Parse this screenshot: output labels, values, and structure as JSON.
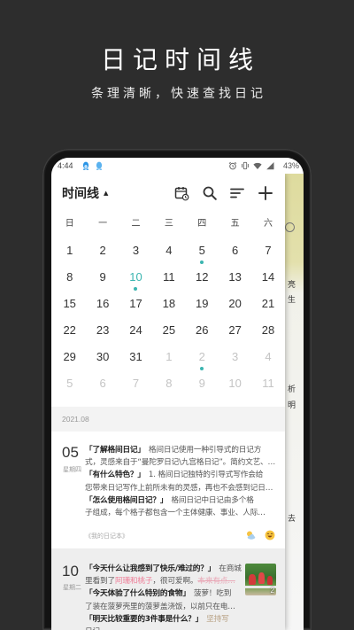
{
  "promo": {
    "title": "日记时间线",
    "subtitle": "条理清晰，快速查找日记"
  },
  "status_bar": {
    "time": "4:44",
    "battery": "43%",
    "left_icons": [
      "qq-icon",
      "qq-icon"
    ],
    "right_icons": [
      "alarm-icon",
      "vibrate-icon",
      "wifi-icon",
      "signal-icon"
    ]
  },
  "header": {
    "title": "时间线",
    "caret": "▲",
    "actions": [
      "calendar-icon",
      "search-icon",
      "sort-icon",
      "add-icon"
    ]
  },
  "calendar": {
    "weekdays": [
      "日",
      "一",
      "二",
      "三",
      "四",
      "五",
      "六"
    ],
    "weeks": [
      [
        {
          "d": "1"
        },
        {
          "d": "2"
        },
        {
          "d": "3"
        },
        {
          "d": "4"
        },
        {
          "d": "5",
          "has_entry": true
        },
        {
          "d": "6"
        },
        {
          "d": "7"
        }
      ],
      [
        {
          "d": "8"
        },
        {
          "d": "9"
        },
        {
          "d": "10",
          "has_entry": true,
          "selected": true
        },
        {
          "d": "11"
        },
        {
          "d": "12"
        },
        {
          "d": "13"
        },
        {
          "d": "14"
        }
      ],
      [
        {
          "d": "15"
        },
        {
          "d": "16"
        },
        {
          "d": "17"
        },
        {
          "d": "18"
        },
        {
          "d": "19"
        },
        {
          "d": "20"
        },
        {
          "d": "21"
        }
      ],
      [
        {
          "d": "22"
        },
        {
          "d": "23"
        },
        {
          "d": "24"
        },
        {
          "d": "25"
        },
        {
          "d": "26"
        },
        {
          "d": "27"
        },
        {
          "d": "28"
        }
      ],
      [
        {
          "d": "29"
        },
        {
          "d": "30"
        },
        {
          "d": "31"
        },
        {
          "d": "1",
          "other_month": true
        },
        {
          "d": "2",
          "other_month": true,
          "has_entry": true
        },
        {
          "d": "3",
          "other_month": true
        },
        {
          "d": "4",
          "other_month": true
        }
      ],
      [
        {
          "d": "5",
          "other_month": true
        },
        {
          "d": "6",
          "other_month": true
        },
        {
          "d": "7",
          "other_month": true
        },
        {
          "d": "8",
          "other_month": true
        },
        {
          "d": "9",
          "other_month": true
        },
        {
          "d": "10",
          "other_month": true
        },
        {
          "d": "11",
          "other_month": true
        }
      ]
    ]
  },
  "timeline": {
    "month_label": "2021.08",
    "entries": [
      {
        "day": "05",
        "weekday": "星期四",
        "lines": [
          [
            {
              "t": "「了解格间日记」",
              "style": "question"
            },
            {
              "t": "格间日记使用一种引导式的日记方"
            }
          ],
          [
            {
              "t": "式，灵感来自于“曼陀罗日记\\九宫格日记”。简约文艺、…"
            }
          ],
          [
            {
              "t": "「有什么特色？」",
              "style": "question"
            },
            {
              "t": "1. 格间日记独特的引导式写作会给"
            }
          ],
          [
            {
              "t": "您带来日记写作上前所未有的灵感，再也不会感到记日…"
            }
          ],
          [
            {
              "t": "「怎么使用格间日记？」",
              "style": "question"
            },
            {
              "t": "格间日记中日记由多个格"
            }
          ],
          [
            {
              "t": "子组成，每个格子都包含一个主体健康、事业、人际…"
            }
          ]
        ],
        "notebook": "《我的日记本》",
        "weather_icon": "sun-cloud-icon",
        "mood_icon": "laughing-face-icon"
      },
      {
        "day": "10",
        "weekday": "星期二",
        "lines": [
          [
            {
              "t": "「今天什么让我感到了快乐/难过的？」",
              "style": "question"
            },
            {
              "t": "在商城"
            }
          ],
          [
            {
              "t": "里看到了"
            },
            {
              "t": "阿珊和桃子",
              "style": "highlight"
            },
            {
              "t": "，很可爱啊。"
            },
            {
              "t": "本来有点…",
              "style": "strike"
            }
          ],
          [
            {
              "t": "「今天体验了什么特别的食物」",
              "style": "question"
            },
            {
              "t": "菠萝！吃到"
            }
          ],
          [
            {
              "t": "了装在菠萝壳里的菠萝盖浇饭，以前只在电…"
            }
          ],
          [
            {
              "t": "「明天比较重要的3件事是什么？」",
              "style": "question"
            },
            {
              "t": "坚持写",
              "style": "muted"
            }
          ],
          [
            {
              "t": "日记…"
            }
          ]
        ],
        "photo_count": "2"
      }
    ]
  },
  "side_peek": {
    "chars": [
      "亮",
      "生",
      "析",
      "明",
      "去"
    ]
  },
  "colors": {
    "accent": "#3bb5b0",
    "background": "#2d2d2d",
    "highlight": "#ee7d97",
    "peek_panel": "#dedb9e"
  }
}
